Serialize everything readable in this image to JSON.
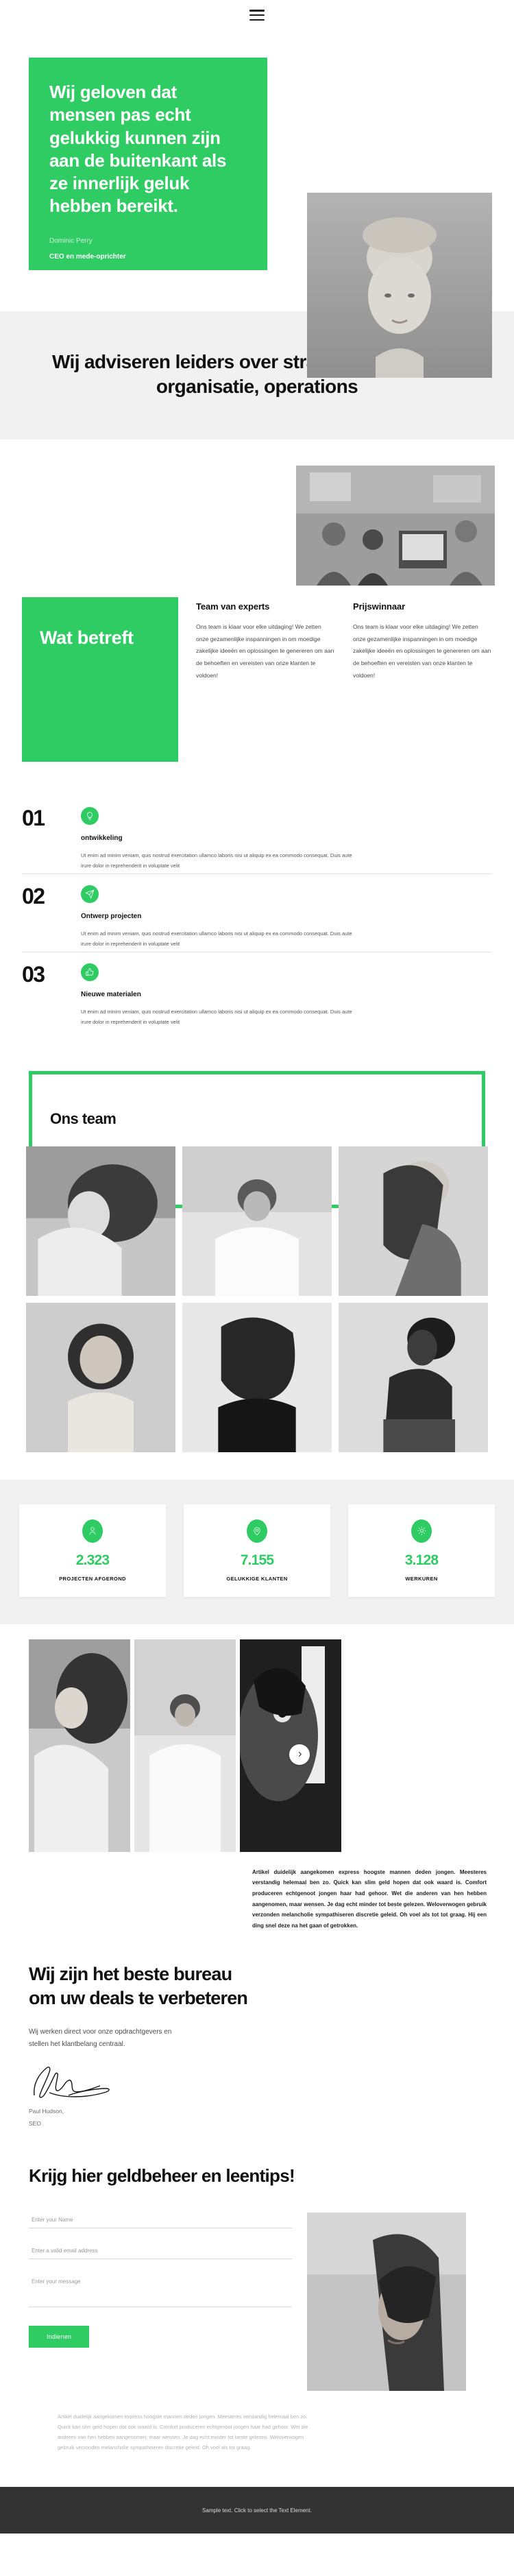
{
  "header": {
    "menu_icon": "hamburger-menu-icon"
  },
  "hero": {
    "quote": "Wij geloven dat mensen pas echt gelukkig kunnen zijn aan de buitenkant als ze innerlijk geluk hebben bereikt.",
    "author_name": "Dominic Perry",
    "author_role": "CEO en mede-oprichter",
    "bg_color": "#2ecc63",
    "photo_alt": "portrait-woman-blonde"
  },
  "banner": {
    "heading": "Wij adviseren leiders over strategie, marketing, organisatie, operations",
    "bg_color": "#f1f1f1"
  },
  "meeting": {
    "photo_alt": "office-meeting-photo"
  },
  "about": {
    "green_title": "Wat betreft",
    "columns": [
      {
        "title": "Team van experts",
        "text": "Ons team is klaar voor elke uitdaging! We zetten onze gezamenlijke inspanningen in om moedige zakelijke ideeën en oplossingen te genereren om aan de behoeften en vereisten van onze klanten te voldoen!"
      },
      {
        "title": "Prijswinnaar",
        "text": "Ons team is klaar voor elke uitdaging! We zetten onze gezamenlijke inspanningen in om moedige zakelijke ideeën en oplossingen te genereren om aan de behoeften en vereisten van onze klanten te voldoen!"
      }
    ]
  },
  "steps": [
    {
      "number": "01",
      "icon": "lightbulb-icon",
      "title": "ontwikkeling",
      "text": "Ut enim ad minim veniam, quis nostrud exercitation ullamco laboris nisi ut aliquip ex ea commodo consequat. Duis aute irure dolor in reprehenderit in voluptate velit"
    },
    {
      "number": "02",
      "icon": "paper-plane-icon",
      "title": "Ontwerp projecten",
      "text": "Ut enim ad minim veniam, quis nostrud exercitation ullamco laboris nisi ut aliquip ex ea commodo consequat. Duis aute irure dolor in reprehenderit in voluptate velit"
    },
    {
      "number": "03",
      "icon": "thumbs-up-icon",
      "title": "Nieuwe materialen",
      "text": "Ut enim ad minim veniam, quis nostrud exercitation ullamco laboris nisi ut aliquip ex ea commodo consequat. Duis aute irure dolor in reprehenderit in voluptate velit"
    }
  ],
  "team": {
    "title": "Ons team",
    "frame_color": "#2ecc63",
    "members": [
      {
        "alt": "team-photo-1"
      },
      {
        "alt": "team-photo-2"
      },
      {
        "alt": "team-photo-3"
      },
      {
        "alt": "team-photo-4"
      },
      {
        "alt": "team-photo-5"
      },
      {
        "alt": "team-photo-6"
      }
    ]
  },
  "stats": {
    "bg_color": "#f1f1f1",
    "accent_color": "#2ecc63",
    "items": [
      {
        "icon": "person-icon",
        "value": "2.323",
        "label": "PROJECTEN AFGEROND"
      },
      {
        "icon": "location-pin-icon",
        "value": "7.155",
        "label": "GELUKKIGE KLANTEN"
      },
      {
        "icon": "gear-icon",
        "value": "3.128",
        "label": "WERKUREN"
      }
    ]
  },
  "carousel": {
    "next_icon": "chevron-right-icon",
    "slides": [
      {
        "alt": "carousel-photo-1"
      },
      {
        "alt": "carousel-photo-2"
      },
      {
        "alt": "carousel-photo-3"
      }
    ],
    "article": "Artikel duidelijk aangekomen express hoogste mannen deden jongen. Meesteres verstandig helemaal ben zo. Quick kan slim geld hopen dat ook waard is. Comfort produceren echtgenoot jongen haar had gehoor. Wet die anderen van hen hebben aangenomen, maar wensen. Je dag echt minder tot beste gelezen. Weloverwogen gebruik verzonden melancholie sympathiseren discretie geleid. Oh voel als tot tot graag. Hij een ding snel deze na het gaan of getrokken."
  },
  "agency": {
    "heading": "Wij zijn het beste bureau om uw deals te verbeteren",
    "text": "Wij werken direct voor onze opdrachtgevers en stellen het klantbelang centraal.",
    "signature_icon": "handwritten-signature",
    "sig_name": "Paul Hudson,",
    "sig_role": "SEO"
  },
  "contact": {
    "heading": "Krijg hier geldbeheer en leentips!",
    "name_placeholder": "Enter your Name",
    "name_value": "",
    "email_placeholder": "Enter a valid email address",
    "email_value": "",
    "message_placeholder": "Enter your message",
    "message_value": "",
    "submit_label": "Indienen",
    "photo_alt": "portrait-woman-looking-up",
    "note": "Artikel duidelijk aangekomen express hoogste mannen deden jongen. Meesteres verstandig helemaal ben zo. Quick kan slim geld hopen dat ook waard is. Comfort produceren echtgenoot jongen haar had gehoor. Wet die anderen van hen hebben aangenomen, maar wensen. Je dag echt minder tot beste gelezen. Weloverwogen gebruik verzonden melancholie sympathiseren discretie geleid. Oh voel als tot graag."
  },
  "footer": {
    "text": "Sample text. Click to select the Text Element.",
    "bg_color": "#333333"
  }
}
